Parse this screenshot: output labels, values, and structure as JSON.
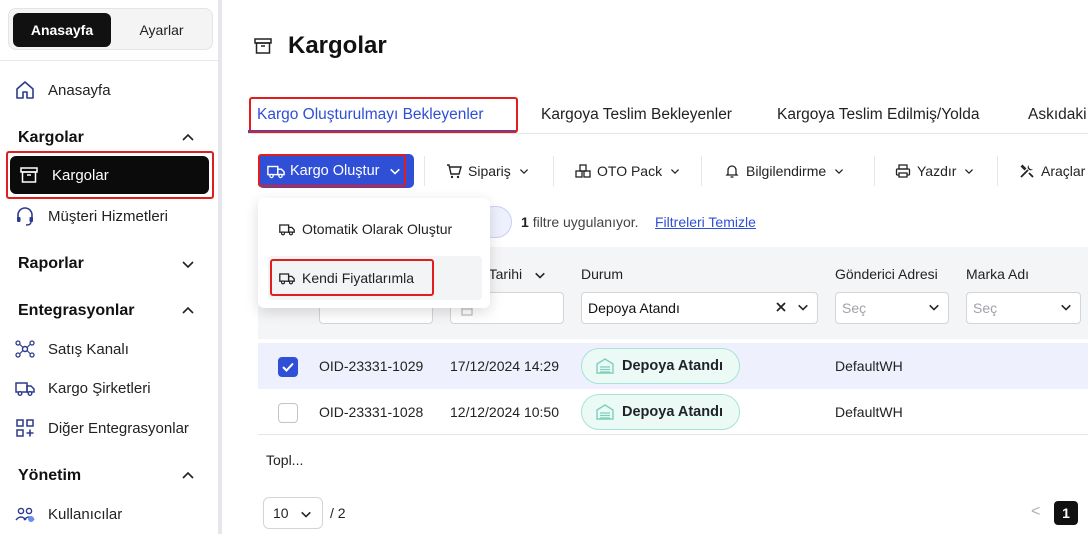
{
  "sidebar": {
    "segment": {
      "active": "Anasayfa",
      "inactive": "Ayarlar"
    },
    "home": "Anasayfa",
    "sections": {
      "kargolar": {
        "title": "Kargolar",
        "items": [
          "Kargolar",
          "Müşteri Hizmetleri"
        ]
      },
      "raporlar": {
        "title": "Raporlar"
      },
      "entegrasyonlar": {
        "title": "Entegrasyonlar",
        "items": [
          "Satış Kanalı",
          "Kargo Şirketleri",
          "Diğer Entegrasyonlar"
        ]
      },
      "yonetim": {
        "title": "Yönetim",
        "items": [
          "Kullanıcılar"
        ]
      }
    }
  },
  "header": {
    "title": "Kargolar"
  },
  "tabs": [
    {
      "label": "Kargo Oluşturulmayı Bekleyenler",
      "active": true
    },
    {
      "label": "Kargoya Teslim Bekleyenler"
    },
    {
      "label": "Kargoya Teslim Edilmiş/Yolda"
    },
    {
      "label": "Askıdaki"
    }
  ],
  "toolbar": {
    "create": "Kargo Oluştur",
    "siparis": "Sipariş",
    "oto_pack": "OTO Pack",
    "bilgilendirme": "Bilgilendirme",
    "yazdir": "Yazdır",
    "araclar": "Araçlar"
  },
  "create_menu": {
    "items": [
      "Otomatik Olarak Oluştur",
      "Kendi Fiyatlarımla"
    ]
  },
  "filter": {
    "count": "1",
    "text": "filtre uygulanıyor.",
    "clear": "Filtreleri Temizle"
  },
  "table": {
    "headers": {
      "date": "ş Tarihi",
      "status": "Durum",
      "sender": "Gönderici Adresi",
      "brand": "Marka Adı"
    },
    "filters": {
      "status_value": "Depoya Atandı",
      "sender_placeholder": "Seç",
      "brand_placeholder": "Seç"
    },
    "rows": [
      {
        "checked": true,
        "order": "OID-23331-1029",
        "date": "17/12/2024 14:29",
        "status": "Depoya Atandı",
        "sender": "DefaultWH"
      },
      {
        "checked": false,
        "order": "OID-23331-1028",
        "date": "12/12/2024 10:50",
        "status": "Depoya Atandı",
        "sender": "DefaultWH"
      }
    ],
    "total": "Topl..."
  },
  "pagination": {
    "page_size": "10",
    "total_pages": "/ 2",
    "prev": "<",
    "current": "1"
  },
  "colors": {
    "accent": "#2f4fd6",
    "highlight": "#e11d1d",
    "badge_bg": "#ecfaf6"
  }
}
